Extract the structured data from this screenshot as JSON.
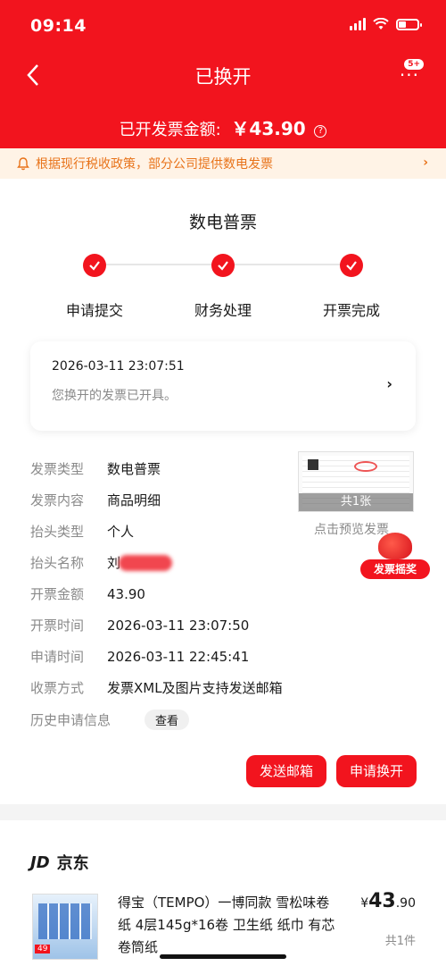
{
  "status_bar": {
    "time": "09:14"
  },
  "header": {
    "title": "已换开",
    "amount_label": "已开发票金额:",
    "amount_value": "￥43.90",
    "badge": "5+"
  },
  "notice": {
    "text": "根据现行税收政策，部分公司提供数电发票"
  },
  "invoice": {
    "type_title": "数电普票",
    "steps": [
      "申请提交",
      "财务处理",
      "开票完成"
    ],
    "status_time": "2026-03-11 23:07:51",
    "status_msg": "您换开的发票已开具。"
  },
  "details": [
    {
      "k": "发票类型",
      "v": "数电普票"
    },
    {
      "k": "发票内容",
      "v": "商品明细"
    },
    {
      "k": "抬头类型",
      "v": "个人"
    },
    {
      "k": "抬头名称",
      "v": "刘"
    },
    {
      "k": "开票金额",
      "v": "43.90"
    },
    {
      "k": "开票时间",
      "v": "2026-03-11 23:07:50"
    },
    {
      "k": "申请时间",
      "v": "2026-03-11 22:45:41"
    },
    {
      "k": "收票方式",
      "v": "发票XML及图片支持发送邮箱"
    },
    {
      "k": "历史申请信息",
      "v": "查看"
    }
  ],
  "preview": {
    "count": "共1张",
    "label": "点击预览发票"
  },
  "lottery": {
    "label": "发票摇奖"
  },
  "buttons": {
    "send_email": "发送邮箱",
    "apply_exchange": "申请换开"
  },
  "product": {
    "shop_logo": "JD",
    "shop": "京东",
    "name": "得宝（TEMPO）一博同款 雪松味卷纸 4层145g*16卷 卫生纸 纸巾 有芯卷筒纸",
    "price_symbol": "¥",
    "price_int": "43",
    "price_dec": ".90",
    "count": "共1件",
    "thumb_tag": "49"
  }
}
